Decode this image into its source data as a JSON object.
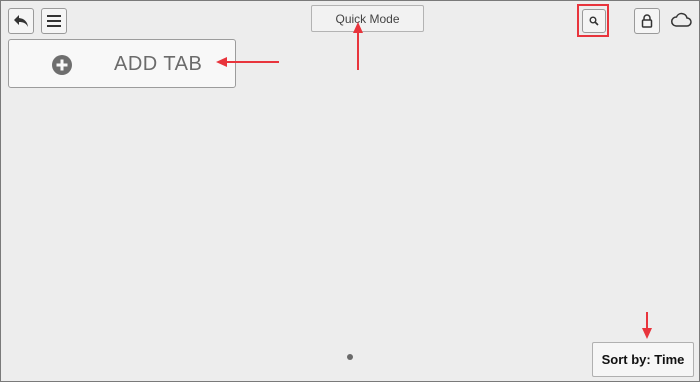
{
  "toolbar": {
    "back_icon": "back-arrow-icon",
    "menu_icon": "hamburger-menu-icon",
    "quick_mode_label": "Quick Mode",
    "search_icon": "search-icon",
    "lock_icon": "lock-icon",
    "cloud_icon": "cloud-icon"
  },
  "add_tab": {
    "label": "ADD TAB",
    "icon": "plus-circle-icon"
  },
  "pagination": {
    "current_page": 1
  },
  "sort": {
    "label": "Sort by: Time"
  },
  "colors": {
    "background": "#ededed",
    "annotation_red": "#e8343c"
  }
}
